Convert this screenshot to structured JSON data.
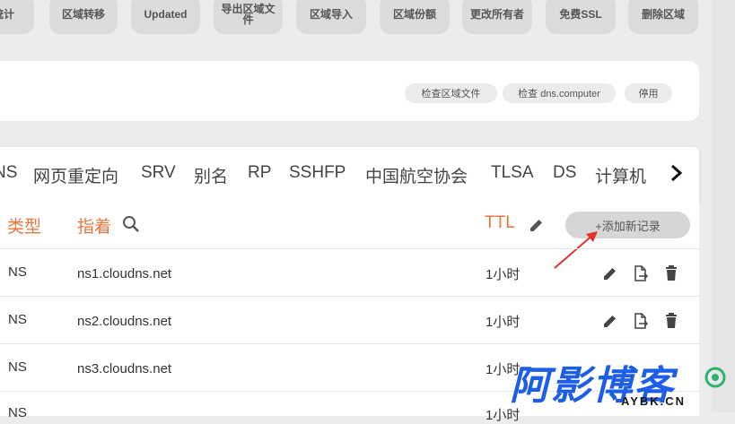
{
  "toolbar": {
    "buttons": [
      "统计",
      "区域转移",
      "Updated",
      "导出区域文\n件",
      "区域导入",
      "区域份额",
      "更改所有者",
      "免费SSL",
      "删除区域"
    ]
  },
  "zone_card": {
    "actions": [
      "检查区域文件",
      "检查 dns.computer",
      "停用"
    ]
  },
  "record_tabs": {
    "items": [
      "NS",
      "网页重定向",
      "SRV",
      "别名",
      "RP",
      "SSHFP",
      "中国航空协会",
      "TLSA",
      "DS",
      "计算机"
    ],
    "next_icon": "chevron-right-icon"
  },
  "records_table": {
    "headers": {
      "type": "类型",
      "points_to": "指着",
      "ttl": "TTL"
    },
    "add_record_label": "+添加新记录",
    "rows": [
      {
        "type": "NS",
        "value": "ns1.cloudns.net",
        "ttl": "1小时"
      },
      {
        "type": "NS",
        "value": "ns2.cloudns.net",
        "ttl": "1小时"
      },
      {
        "type": "NS",
        "value": "ns3.cloudns.net",
        "ttl": "1小时"
      },
      {
        "type": "NS",
        "value": "",
        "ttl": "1小时"
      }
    ]
  },
  "watermark": {
    "main": "阿影博客",
    "sub": "AYBK.CN"
  },
  "colors": {
    "accent": "#e8753a",
    "arrow": "#e0342b",
    "watermark": "#1d5ee8"
  }
}
